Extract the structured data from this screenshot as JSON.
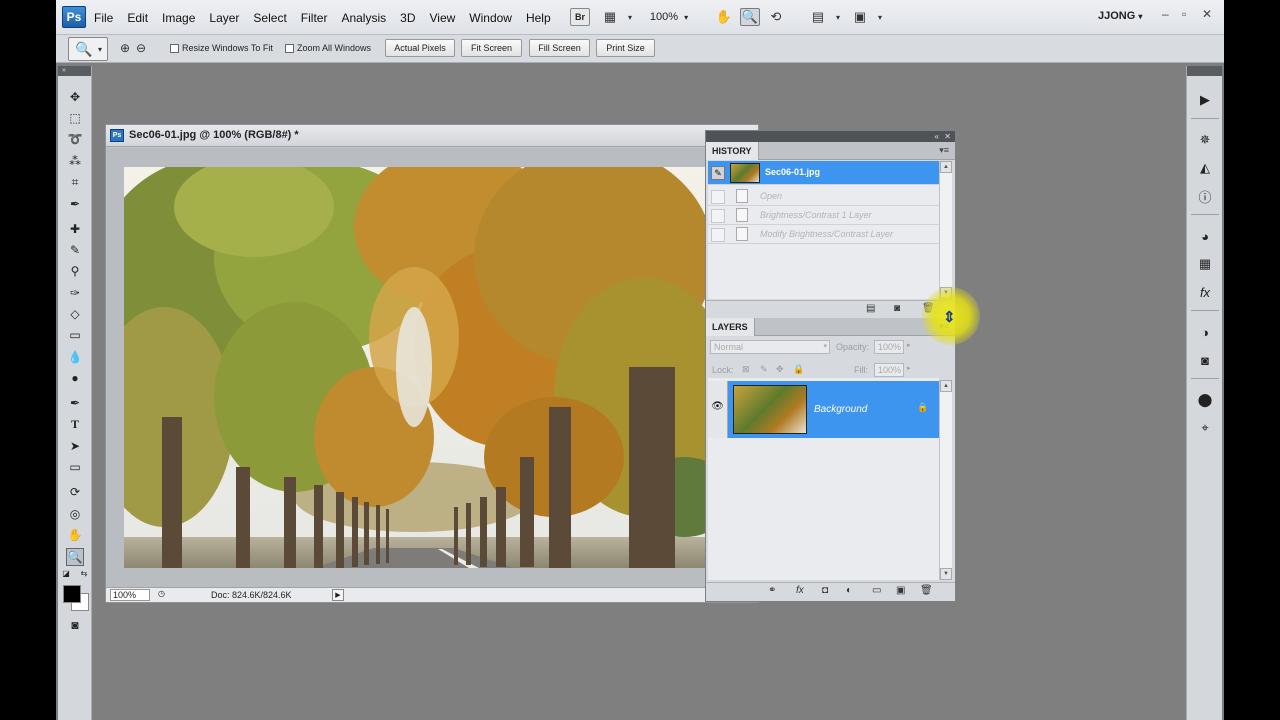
{
  "app": {
    "logo": "Ps",
    "menu": [
      "File",
      "Edit",
      "Image",
      "Layer",
      "Select",
      "Filter",
      "Analysis",
      "3D",
      "View",
      "Window",
      "Help"
    ],
    "bridge_label": "Br",
    "zoom_level": "100%",
    "user": "JJONG",
    "user_caret": "▾",
    "window_controls": {
      "minimize": "–",
      "restore": "▫",
      "close": "✕"
    }
  },
  "options_bar": {
    "resize_windows_label": "Resize Windows To Fit",
    "zoom_all_windows_label": "Zoom All Windows",
    "actual_pixels": "Actual Pixels",
    "fit_screen": "Fit Screen",
    "fill_screen": "Fill Screen",
    "print_size": "Print Size"
  },
  "document": {
    "title": "Sec06-01.jpg @ 100% (RGB/8#) *",
    "zoom": "100%",
    "doc_size": "Doc: 824.6K/824.6K"
  },
  "history": {
    "tab_label": "HISTORY",
    "snapshot_name": "Sec06-01.jpg",
    "states": [
      "Open",
      "Brightness/Contrast 1 Layer",
      "Modify Brightness/Contrast Layer"
    ]
  },
  "layers": {
    "tab_label": "LAYERS",
    "blend_mode": "Normal",
    "opacity_label": "Opacity:",
    "opacity_value": "100%",
    "lock_label": "Lock:",
    "fill_label": "Fill:",
    "fill_value": "100%",
    "layer_name": "Background"
  },
  "colors": {
    "selection_blue": "#3d95ef",
    "workspace_gray": "#7f7f7f",
    "highlight_yellow": "#ece81e"
  }
}
